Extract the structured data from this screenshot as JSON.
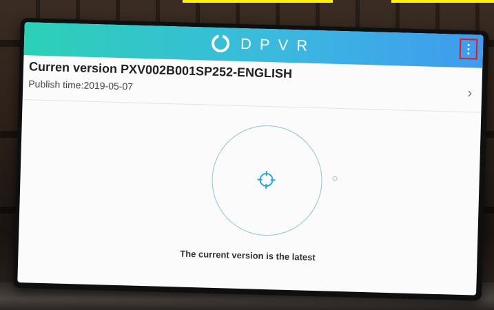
{
  "header": {
    "logo_text": "DPVR",
    "menu_icon_char": "⋮"
  },
  "version": {
    "title": "Curren version PXV002B001SP252-ENGLISH",
    "publish_time": "Publish time:2019-05-07",
    "chevron": "›"
  },
  "status": {
    "message": "The current version is the latest"
  },
  "colors": {
    "titlebar_start": "#2cd0b7",
    "titlebar_end": "#3f9bef",
    "menu_highlight": "#e21a1a"
  }
}
